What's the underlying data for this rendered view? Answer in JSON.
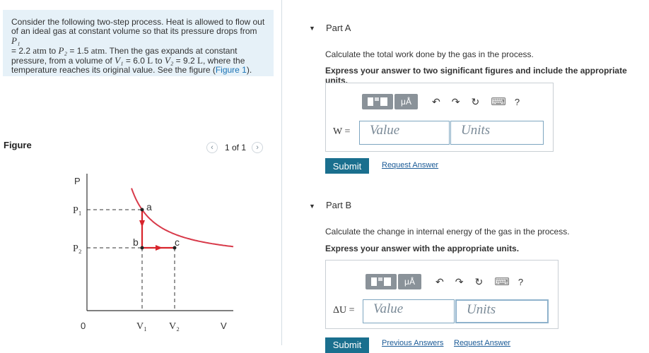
{
  "problem": {
    "line1": "Consider the following two-step process. Heat is allowed to flow out",
    "line2_text": "of an ideal gas at constant volume so that its pressure drops from ",
    "line2_var": "P₁",
    "line3_a": "= 2.2 ",
    "line3_u1": "atm",
    "line3_b": " to ",
    "line3_var": "P₂",
    "line3_c": " = 1.5 ",
    "line3_u2": "atm",
    "line3_d": ". Then the gas expands at constant",
    "line4_a": "pressure, from a volume of ",
    "line4_v1": "V₁",
    "line4_b": " = 6.0 ",
    "line4_u1": "L",
    "line4_c": " to ",
    "line4_v2": "V₂",
    "line4_d": " = 9.2 ",
    "line4_u2": "L",
    "line4_e": ", where the",
    "line5_a": "temperature reaches its original value. See the figure (",
    "line5_link": "Figure 1",
    "line5_b": ")."
  },
  "figure": {
    "title": "Figure",
    "pager_text": "1 of 1",
    "prev_icon": "‹",
    "next_icon": "›",
    "axis_p": "P",
    "axis_v": "V",
    "origin": "0",
    "p1": "P₁",
    "p2": "P₂",
    "v1": "V₁",
    "v2": "V₂",
    "pt_a": "a",
    "pt_b": "b",
    "pt_c": "c",
    "curve_color": "#d83a4a",
    "path_color": "#d8242c"
  },
  "partA": {
    "caret": "▼",
    "header": "Part A",
    "question": "Calculate the total work done by the gas in the process.",
    "instruction": "Express your answer to two significant figures and include the appropriate units.",
    "var_label": "W =",
    "value_placeholder": "Value",
    "units_placeholder": "Units",
    "submit": "Submit",
    "request": "Request Answer"
  },
  "partB": {
    "caret": "▼",
    "header": "Part B",
    "question": "Calculate the change in internal energy of the gas in the process.",
    "instruction": "Express your answer with the appropriate units.",
    "var_label": "ΔU =",
    "value_placeholder": "Value",
    "units_placeholder": "Units",
    "submit": "Submit",
    "previous": "Previous Answers",
    "request": "Request Answer"
  },
  "toolbar": {
    "mu_label": "μÅ",
    "undo_icon": "↶",
    "redo_icon": "↷",
    "reset_icon": "↻",
    "keyboard_icon": "⌨",
    "help_label": "?"
  },
  "colors": {
    "accent": "#1a6f8e",
    "link": "#1a73b5",
    "panel": "#e6f1f8"
  }
}
